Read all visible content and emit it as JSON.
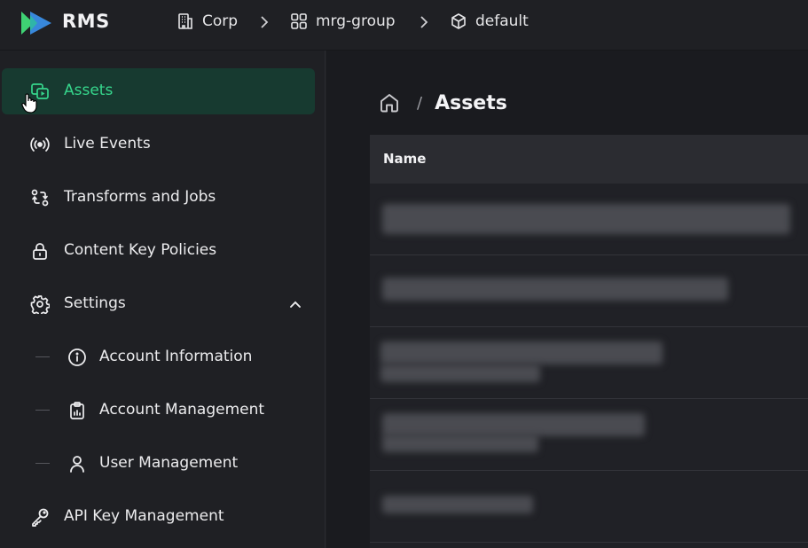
{
  "app": {
    "brand": "RMS"
  },
  "breadcrumbs": [
    {
      "label": "Corp",
      "icon": "building-icon"
    },
    {
      "label": "mrg-group",
      "icon": "grid-icon"
    },
    {
      "label": "default",
      "icon": "cube-icon"
    }
  ],
  "sidebar": {
    "items": [
      {
        "label": "Assets",
        "icon": "assets-icon",
        "active": true
      },
      {
        "label": "Live Events",
        "icon": "broadcast-icon"
      },
      {
        "label": "Transforms and Jobs",
        "icon": "transform-icon"
      },
      {
        "label": "Content Key Policies",
        "icon": "lock-icon"
      },
      {
        "label": "Settings",
        "icon": "gear-icon",
        "expanded": true
      },
      {
        "label": "Account Information",
        "icon": "info-icon",
        "sub": true
      },
      {
        "label": "Account Management",
        "icon": "clipboard-icon",
        "sub": true
      },
      {
        "label": "User Management",
        "icon": "user-icon",
        "sub": true
      },
      {
        "label": "API Key Management",
        "icon": "key-icon"
      }
    ]
  },
  "main": {
    "title": "Assets",
    "breadcrumb_separator": "/",
    "table": {
      "columns": [
        "Name"
      ]
    }
  },
  "colors": {
    "accent": "#36d68c",
    "active_bg": "#173a30",
    "logo_green": "#3fd173",
    "logo_blue": "#3a8ee6"
  }
}
